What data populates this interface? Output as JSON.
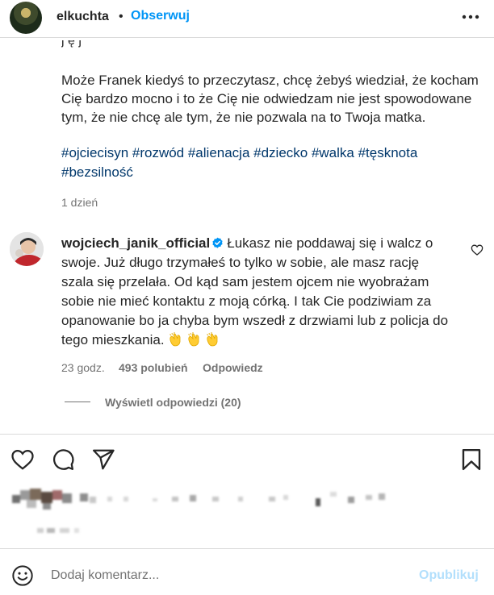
{
  "header": {
    "username": "elkuchta",
    "separator": "•",
    "follow_label": "Obserwuj"
  },
  "post": {
    "cut_line": "j                           ę       j",
    "caption": "Może Franek kiedyś to przeczytasz, chcę żebyś wiedział, że kocham Cię bardzo mocno i to że Cię nie odwiedzam nie jest spowodowane tym, że nie chcę ale tym, że nie pozwala na to Twoja matka.",
    "hashtags": "#ojciecisyn #rozwód #alienacja #dziecko #walka #tęsknota #bezsilność",
    "time": "1 dzień"
  },
  "comment": {
    "username": "wojciech_janik_official",
    "text": "Łukasz nie poddawaj się i walcz o swoje. Już długo trzymałeś to tylko w sobie, ale masz rację szala się przelała. Od kąd sam jestem ojcem nie wyobrażam sobie nie mieć kontaktu z moją córką. I tak Cie podziwiam za opanowanie bo ja chyba bym wszedł z drzwiami lub z policja do tego mieszkania.",
    "time": "23 godz.",
    "likes": "493 polubień",
    "reply_label": "Odpowiedz",
    "view_replies": "Wyświetl odpowiedzi (20)"
  },
  "icons": [
    "more-icon",
    "heart-icon",
    "comment-icon",
    "share-icon",
    "bookmark-icon",
    "emoji-icon",
    "verified-icon",
    "clap-icon"
  ],
  "composer": {
    "placeholder": "Dodaj komentarz...",
    "publish_label": "Opublikuj"
  },
  "colors": {
    "link": "#0095f6",
    "hashtag": "#00376b",
    "muted": "#737373",
    "publish_disabled": "#b2dffc",
    "verified": "#0095f6"
  }
}
